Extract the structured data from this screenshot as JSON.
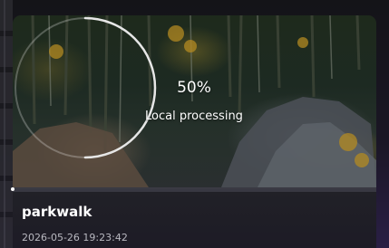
{
  "item": {
    "title": "parkwalk",
    "timestamp": "2026-05-26 19:23:42"
  },
  "processing": {
    "progress_text": "50%",
    "progress_fraction": 0.5,
    "status_label": "Local processing",
    "ring_color": "#e6e6e6"
  },
  "icons": {
    "progress": "progress-ring-icon"
  }
}
